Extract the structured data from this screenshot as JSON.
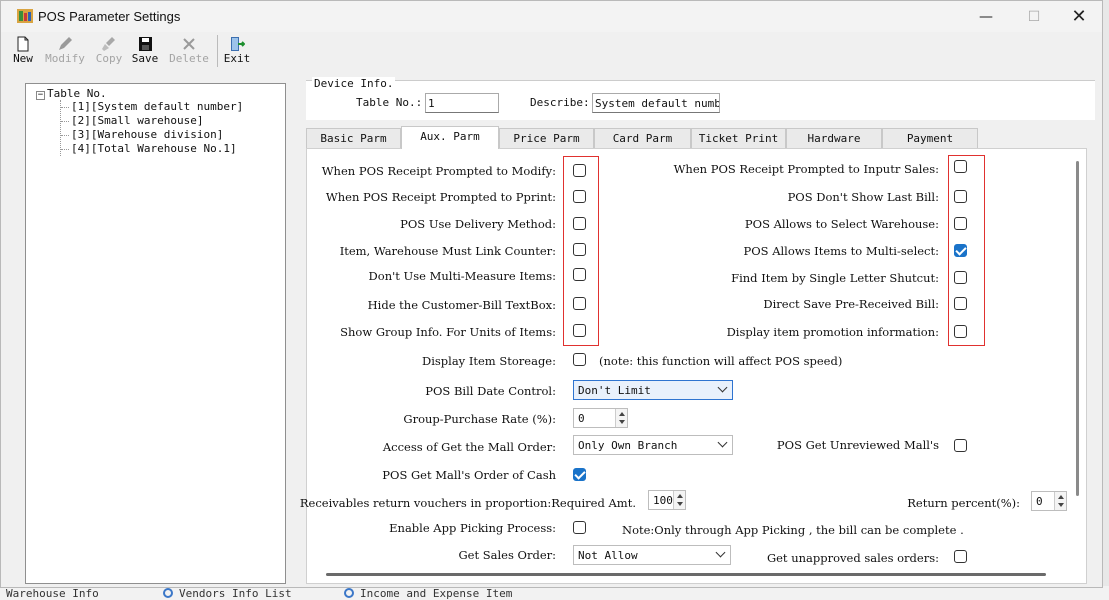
{
  "background_strip": {
    "items": [
      "Warehouse Info",
      "Vendors Info List",
      "Income and Expense Item"
    ]
  },
  "window": {
    "title": "POS Parameter Settings",
    "controls": {
      "minimize": "—",
      "maximize": "☐",
      "close": "✕"
    }
  },
  "toolbar": {
    "new": "New",
    "modify": "Modify",
    "copy": "Copy",
    "save": "Save",
    "delete": "Delete",
    "exit": "Exit"
  },
  "tree": {
    "root": "Table No.",
    "items": [
      "[1][System default number]",
      "[2][Small warehouse]",
      "[3][Warehouse division]",
      "[4][Total Warehouse No.1]"
    ]
  },
  "device": {
    "title": "Device Info.",
    "table_no_label": "Table No.:",
    "table_no_value": "1",
    "describe_label": "Describe:",
    "describe_value": "System default number"
  },
  "tabs": [
    "Basic Parm",
    "Aux. Parm",
    "Price Parm",
    "Card Parm",
    "Ticket Print",
    "Hardware",
    "Payment"
  ],
  "active_tab": "Aux. Parm",
  "aux": {
    "left_options": [
      {
        "label": "When POS Receipt Prompted to Modify:",
        "checked": false
      },
      {
        "label": "When POS Receipt Prompted to Pprint:",
        "checked": false
      },
      {
        "label": "POS Use Delivery Method:",
        "checked": false
      },
      {
        "label": "Item, Warehouse Must Link Counter:",
        "checked": false
      },
      {
        "label": "Don't Use Multi-Measure Items:",
        "checked": false
      },
      {
        "label": "Hide the Customer-Bill TextBox:",
        "checked": false
      },
      {
        "label": "Show Group Info. For Units of Items:",
        "checked": false
      }
    ],
    "right_options": [
      {
        "label": "When POS Receipt Prompted to Inputr Sales:",
        "checked": false
      },
      {
        "label": "POS Don't Show Last Bill:",
        "checked": false
      },
      {
        "label": "POS Allows to Select Warehouse:",
        "checked": false
      },
      {
        "label": "POS Allows Items to Multi-select:",
        "checked": true
      },
      {
        "label": "Find Item by Single Letter Shutcut:",
        "checked": false
      },
      {
        "label": "Direct Save Pre-Received Bill:",
        "checked": false
      },
      {
        "label": "Display item promotion information:",
        "checked": false
      }
    ],
    "display_item_storage": {
      "label": "Display Item Storeage:",
      "checked": false,
      "note": "(note: this function will affect POS speed)"
    },
    "bill_date_control": {
      "label": "POS Bill Date Control:",
      "value": "Don't Limit"
    },
    "group_purchase_rate": {
      "label": "Group-Purchase Rate (%):",
      "value": "0"
    },
    "mall_order_access": {
      "label": "Access of Get the Mall Order:",
      "value": "Only Own Branch"
    },
    "unreviewed_mall": {
      "label": "POS Get Unreviewed  Mall's",
      "checked": false
    },
    "mall_order_cash": {
      "label": "POS Get Mall's Order of Cash",
      "checked": true
    },
    "receivables": {
      "label": "Receivables return vouchers in proportion:Required Amt.",
      "value": "100",
      "return_label": "Return percent(%):",
      "return_value": "0"
    },
    "app_picking": {
      "label": "Enable App Picking Process:",
      "checked": false,
      "note": "Note:Only through App Picking , the bill can be complete ."
    },
    "sales_order": {
      "label": "Get Sales Order:",
      "value": "Not Allow"
    },
    "unapproved_sales": {
      "label": "Get unapproved sales orders:",
      "checked": false
    }
  },
  "colors": {
    "accent": "#1a73c9",
    "highlight_box": "#e0312f"
  }
}
